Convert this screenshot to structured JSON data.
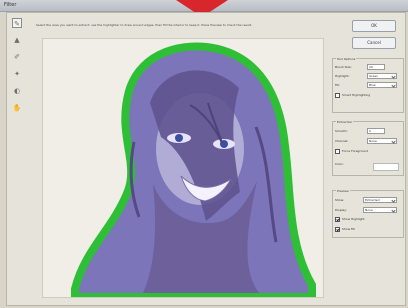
{
  "window": {
    "title": "Filter",
    "instruction": "Select the area you want to extract: use the highlighter to draw around edges, then fill the interior to keep it. Press Preview to check the result."
  },
  "tools": [
    {
      "name": "edge-highlighter-icon",
      "selected": true,
      "glyph": "✎"
    },
    {
      "name": "fill-tool-icon",
      "selected": false,
      "glyph": "▲"
    },
    {
      "name": "eraser-icon",
      "selected": false,
      "glyph": "✐"
    },
    {
      "name": "eyedropper-icon",
      "selected": false,
      "glyph": "✦"
    },
    {
      "name": "cleanup-tool-icon",
      "selected": false,
      "glyph": "◐"
    },
    {
      "name": "edge-touchup-icon",
      "selected": false,
      "glyph": "✋"
    }
  ],
  "buttons": {
    "ok": "OK",
    "cancel": "Cancel"
  },
  "tool_options": {
    "title": "Tool Options",
    "brush_size": {
      "label": "Brush Size:",
      "value": "20"
    },
    "highlight": {
      "label": "Highlight:",
      "value": "Green"
    },
    "fill": {
      "label": "Fill:",
      "value": "Blue"
    },
    "smart_highlighting": {
      "label": "Smart Highlighting",
      "checked": false
    }
  },
  "extraction": {
    "title": "Extraction",
    "smooth": {
      "label": "Smooth:",
      "value": "0"
    },
    "channel": {
      "label": "Channel:",
      "value": "None"
    },
    "force_foreground": {
      "label": "Force Foreground",
      "checked": false
    },
    "color_label": "Color:"
  },
  "preview": {
    "title": "Preview",
    "show": {
      "label": "Show:",
      "value": "Extracted"
    },
    "display": {
      "label": "Display:",
      "value": "None"
    },
    "show_highlight": {
      "label": "Show Highlight",
      "checked": true
    },
    "show_fill": {
      "label": "Show Fill",
      "checked": true
    }
  },
  "colors": {
    "highlight": "#2fbf37",
    "fill": "#7d75b9",
    "button_border": "#9aa0a8",
    "arrow": "#d8262d"
  }
}
